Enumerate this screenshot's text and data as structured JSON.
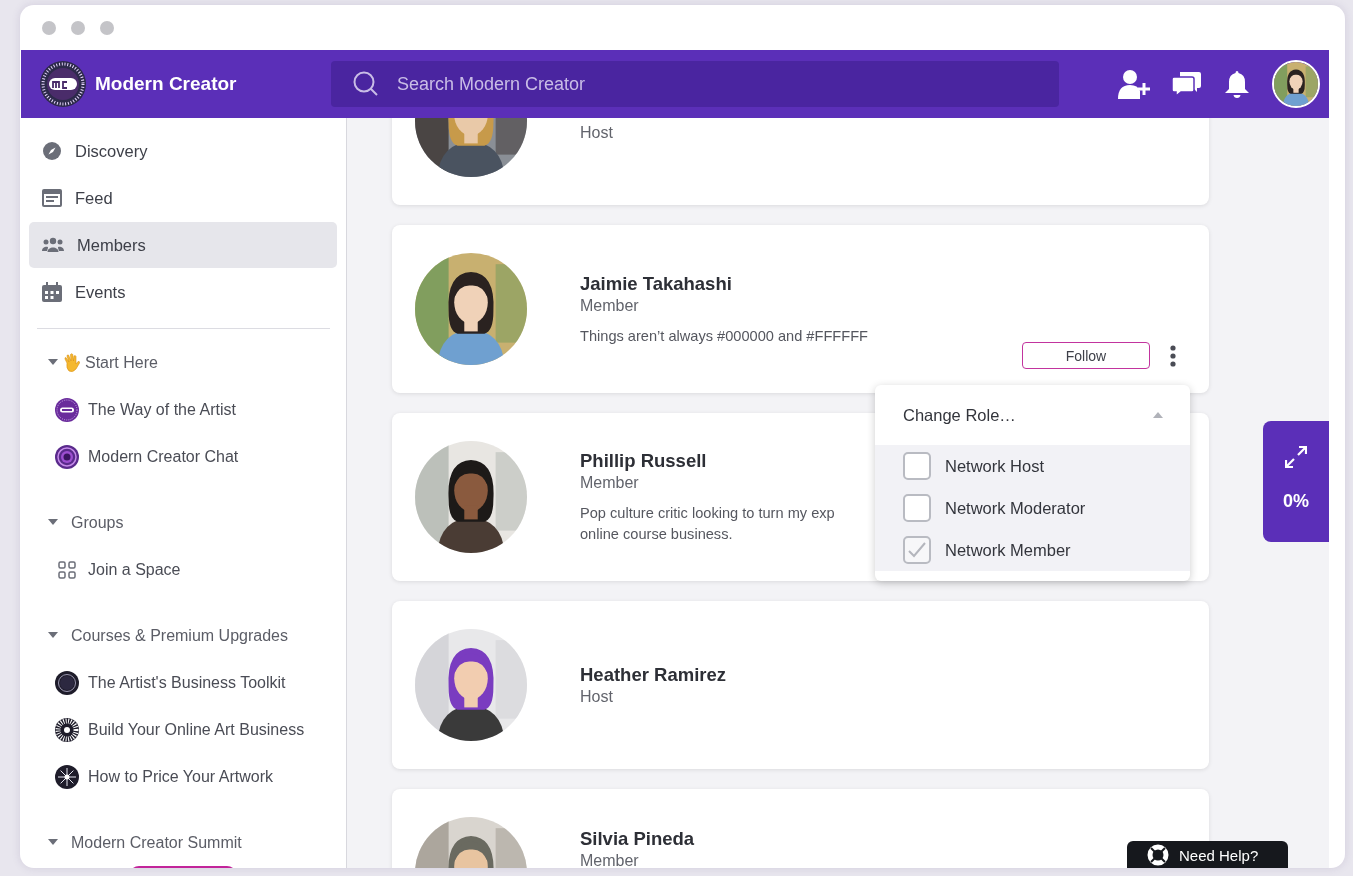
{
  "header": {
    "brand": "Modern Creator",
    "search": {
      "placeholder": "Search Modern Creator"
    }
  },
  "sidebar": {
    "nav": [
      {
        "label": "Discovery",
        "selected": false
      },
      {
        "label": "Feed",
        "selected": false
      },
      {
        "label": "Members",
        "selected": true
      },
      {
        "label": "Events",
        "selected": false
      }
    ],
    "sections": [
      {
        "title": "Start Here",
        "expanded": true,
        "items": [
          {
            "kind": "link",
            "label": "The Way of the Artist"
          },
          {
            "kind": "link",
            "label": "Modern Creator Chat"
          }
        ]
      },
      {
        "title": "Groups",
        "expanded": true,
        "items": [
          {
            "kind": "link",
            "label": "Join a Space"
          }
        ]
      },
      {
        "title": "Courses & Premium Upgrades",
        "expanded": true,
        "items": [
          {
            "kind": "link",
            "label": "The Artist's Business Toolkit"
          },
          {
            "kind": "link",
            "label": "Build Your Online Art Business"
          },
          {
            "kind": "link",
            "label": "How to Price Your Artwork"
          }
        ]
      },
      {
        "title": "Modern Creator Summit",
        "expanded": true,
        "items": [
          {
            "kind": "button"
          }
        ]
      }
    ]
  },
  "members": [
    {
      "role": "Host"
    },
    {
      "name": "Jaimie Takahashi",
      "role": "Member",
      "bio_lines": [
        "Things aren’t always #000000 and #FFFFFF"
      ],
      "follow_button": "Follow",
      "menu": true
    },
    {
      "name": "Phillip Russell",
      "role": "Member",
      "bio_lines": [
        "Pop culture critic looking to turn my exp",
        "online course business."
      ]
    },
    {
      "name": "Heather Ramirez",
      "role": "Host"
    },
    {
      "name": "Silvia Pineda",
      "role": "Member"
    }
  ],
  "role_menu": {
    "title": "Change Role…",
    "options": [
      {
        "label": "Network Host",
        "checked": false
      },
      {
        "label": "Network Moderator",
        "checked": false
      },
      {
        "label": "Network Member",
        "checked": true
      }
    ]
  },
  "progress_widget": {
    "label": "0%"
  },
  "help_button": {
    "label": "Need Help?"
  }
}
